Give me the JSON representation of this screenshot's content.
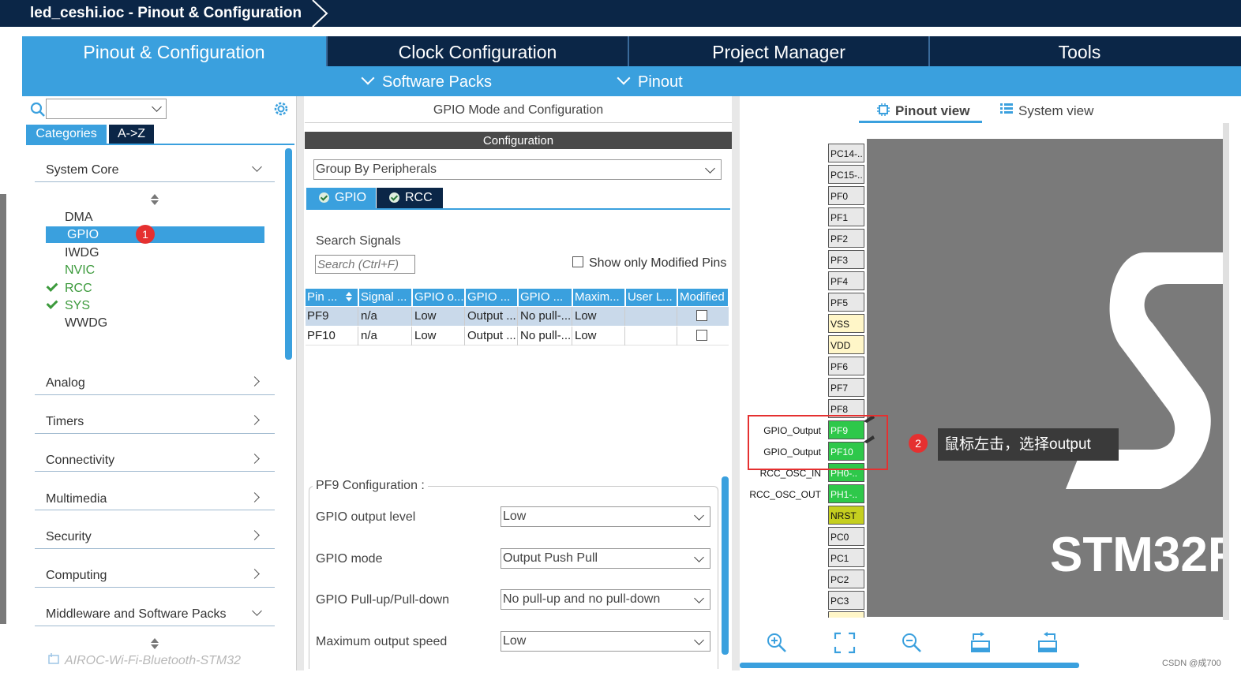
{
  "window": {
    "title": "led_ceshi.ioc - Pinout & Configuration"
  },
  "nav": {
    "tabs": [
      "Pinout & Configuration",
      "Clock Configuration",
      "Project Manager",
      "Tools"
    ],
    "sub": [
      "Software Packs",
      "Pinout"
    ]
  },
  "left": {
    "tabs": [
      "Categories",
      "A->Z"
    ],
    "system_core": "System Core",
    "items": [
      "DMA",
      "GPIO",
      "IWDG",
      "NVIC",
      "RCC",
      "SYS",
      "WWDG"
    ],
    "sections": [
      "Analog",
      "Timers",
      "Connectivity",
      "Multimedia",
      "Security",
      "Computing",
      "Middleware and Software Packs"
    ],
    "package_item": "AIROC-Wi-Fi-Bluetooth-STM32",
    "badge1": "1"
  },
  "middle": {
    "header": "GPIO Mode and Configuration",
    "config_bar": "Configuration",
    "group_by": "Group By Peripherals",
    "tabs": [
      "GPIO",
      "RCC"
    ],
    "search_label": "Search Signals",
    "search_placeholder": "Search (Ctrl+F)",
    "modified_only": "Show only Modified Pins",
    "columns": [
      "Pin ...",
      "Signal ...",
      "GPIO o...",
      "GPIO ...",
      "GPIO ...",
      "Maxim...",
      "User L...",
      "Modified"
    ],
    "rows": [
      [
        "PF9",
        "n/a",
        "Low",
        "Output ...",
        "No pull-...",
        "Low",
        ""
      ],
      [
        "PF10",
        "n/a",
        "Low",
        "Output ...",
        "No pull-...",
        "Low",
        ""
      ]
    ],
    "pf9_config": "PF9 Configuration :",
    "fields": [
      {
        "label": "GPIO output level",
        "value": "Low"
      },
      {
        "label": "GPIO mode",
        "value": "Output Push Pull"
      },
      {
        "label": "GPIO Pull-up/Pull-down",
        "value": "No pull-up and no pull-down"
      },
      {
        "label": "Maximum output speed",
        "value": "Low"
      }
    ]
  },
  "right": {
    "views": [
      "Pinout view",
      "System view"
    ],
    "pins": [
      "PC14-..",
      "PC15-..",
      "PF0",
      "PF1",
      "PF2",
      "PF3",
      "PF4",
      "PF5",
      "VSS",
      "VDD",
      "PF6",
      "PF7",
      "PF8",
      "PF9",
      "PF10",
      "PH0-..",
      "PH1-..",
      "NRST",
      "PC0",
      "PC1",
      "PC2",
      "PC3"
    ],
    "pin_labels": {
      "pf9": "GPIO_Output",
      "pf10": "GPIO_Output",
      "ph0": "RCC_OSC_IN",
      "ph1": "RCC_OSC_OUT"
    },
    "chip_text": "STM32F",
    "tooltip": "鼠标左击，选择output",
    "badge2": "2",
    "watermark": "CSDN @成700",
    "colors": {
      "active_pin": "#2ec84a",
      "power_pin": "#fff6c8",
      "reset_pin": "#c5cf1f",
      "accent": "#3aa0de"
    }
  }
}
